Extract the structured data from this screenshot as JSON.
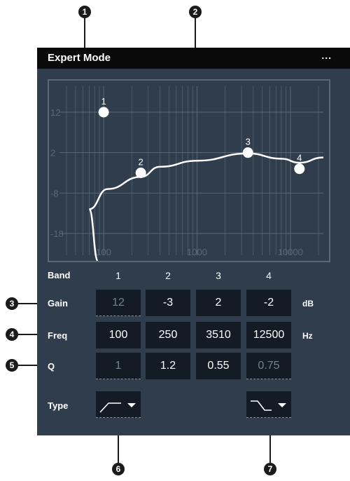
{
  "callouts": [
    "1",
    "2",
    "3",
    "4",
    "5",
    "6",
    "7"
  ],
  "window": {
    "title": "Expert Mode",
    "menu_label": "..."
  },
  "graph": {
    "y_ticks": [
      "12",
      "2",
      "-8",
      "-18"
    ],
    "x_ticks": [
      "100",
      "1000",
      "10000"
    ],
    "points": [
      {
        "label": "1",
        "freq": 100,
        "gain": 12
      },
      {
        "label": "2",
        "freq": 250,
        "gain": -3
      },
      {
        "label": "3",
        "freq": 3510,
        "gain": 2
      },
      {
        "label": "4",
        "freq": 12500,
        "gain": -2
      }
    ],
    "colors": {
      "background": "#2f3d4c",
      "grid": "#5b6875",
      "curve": "#ffffff"
    }
  },
  "table": {
    "band_label": "Band",
    "bands": [
      "1",
      "2",
      "3",
      "4"
    ],
    "rows": [
      {
        "label": "Gain",
        "values": [
          "12",
          "-3",
          "2",
          "-2"
        ],
        "disabled": [
          true,
          false,
          false,
          false
        ],
        "unit": "dB"
      },
      {
        "label": "Freq",
        "values": [
          "100",
          "250",
          "3510",
          "12500"
        ],
        "disabled": [
          false,
          false,
          false,
          false
        ],
        "unit": "Hz"
      },
      {
        "label": "Q",
        "values": [
          "1",
          "1.2",
          "0.55",
          "0.75"
        ],
        "disabled": [
          true,
          false,
          false,
          true
        ],
        "unit": ""
      }
    ],
    "type_label": "Type",
    "type_controls": [
      {
        "band": "1",
        "shape": "low-cut-filter-icon"
      },
      {
        "band": "4",
        "shape": "high-cut-filter-icon"
      }
    ]
  }
}
